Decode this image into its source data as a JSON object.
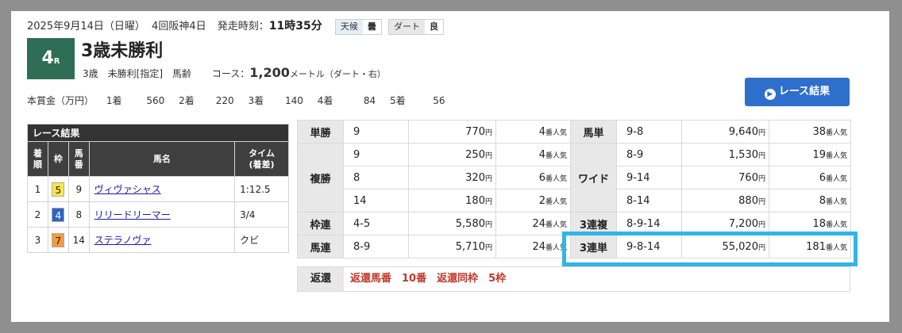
{
  "header": {
    "date": "2025年9月14日（日曜）",
    "meeting": "4回阪神4日",
    "start_label": "発走時刻：",
    "start_time": "11時35分",
    "weather_label": "天候",
    "weather": "曇",
    "track_label": "ダート",
    "track_cond": "良"
  },
  "race": {
    "number": "4",
    "r_suffix": "R",
    "name": "3歳未勝利",
    "info": "3歳　未勝利[指定]　馬齢",
    "course_label": "コース：",
    "distance": "1,200",
    "unit": "メートル（ダート・右）"
  },
  "prize": {
    "label": "本賞金（万円）",
    "items": [
      {
        "place": "1着",
        "amount": "560"
      },
      {
        "place": "2着",
        "amount": "220"
      },
      {
        "place": "3着",
        "amount": "140"
      },
      {
        "place": "4着",
        "amount": "84"
      },
      {
        "place": "5着",
        "amount": "56"
      }
    ]
  },
  "results_button": "レース結果",
  "results": {
    "caption": "レース結果",
    "headers": [
      "着順",
      "枠",
      "馬番",
      "馬名",
      "タイム\n(着差)"
    ],
    "rows": [
      {
        "rank": "1",
        "frame": "5",
        "num": "9",
        "name": "ヴィヴァシャス",
        "time": "1:12.5"
      },
      {
        "rank": "2",
        "frame": "4",
        "num": "8",
        "name": "リリードリーマー",
        "time": "3/4"
      },
      {
        "rank": "3",
        "frame": "7",
        "num": "14",
        "name": "ステラノヴァ",
        "time": "クビ"
      }
    ]
  },
  "payout": {
    "yen": "円",
    "ninki": "番人気",
    "tansho": {
      "label": "単勝",
      "combo": "9",
      "pay": "770",
      "pop": "4"
    },
    "fukusho": {
      "label": "複勝",
      "rows": [
        {
          "combo": "9",
          "pay": "250",
          "pop": "4"
        },
        {
          "combo": "8",
          "pay": "320",
          "pop": "6"
        },
        {
          "combo": "14",
          "pay": "180",
          "pop": "2"
        }
      ]
    },
    "wakuren": {
      "label": "枠連",
      "combo": "4-5",
      "pay": "5,580",
      "pop": "24"
    },
    "umaren": {
      "label": "馬連",
      "combo": "8-9",
      "pay": "5,710",
      "pop": "24"
    },
    "umatan": {
      "label": "馬単",
      "combo": "9-8",
      "pay": "9,640",
      "pop": "38"
    },
    "wide": {
      "label": "ワイド",
      "rows": [
        {
          "combo": "8-9",
          "pay": "1,530",
          "pop": "19"
        },
        {
          "combo": "9-14",
          "pay": "760",
          "pop": "6"
        },
        {
          "combo": "8-14",
          "pay": "880",
          "pop": "8"
        }
      ]
    },
    "sanrenpuku": {
      "label": "3連複",
      "combo": "8-9-14",
      "pay": "7,200",
      "pop": "18"
    },
    "sanrentan": {
      "label": "3連単",
      "combo": "9-8-14",
      "pay": "55,020",
      "pop": "181"
    }
  },
  "refund": {
    "label": "返還",
    "text": "返還馬番　10番　返還同枠　5枠"
  },
  "colors": {
    "race_box": "#2e6e57",
    "button": "#2f6fcc",
    "highlight": "#33b4e6",
    "frame_5": "#f7e64a",
    "frame_4": "#2f62c2",
    "frame_7": "#f39c3a",
    "refund_text": "#c0392b"
  }
}
